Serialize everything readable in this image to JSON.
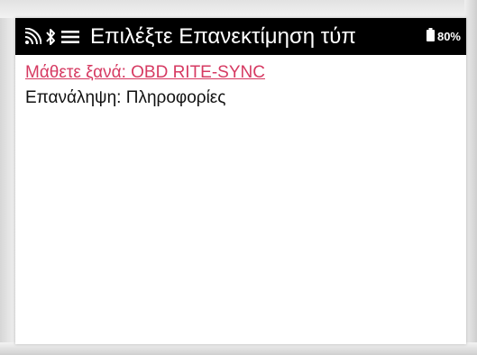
{
  "status_bar": {
    "title": "Επιλέξτε Επανεκτίμηση τύπ",
    "battery_percent": "80%",
    "icons": [
      "signal-icon",
      "bluetooth-icon",
      "menu-icon",
      "battery-icon"
    ],
    "background_color": "#000000",
    "text_color": "#ffffff"
  },
  "menu": {
    "items": [
      {
        "label": "Μάθετε ξανά: OBD RITE-SYNC",
        "selected": true,
        "color": "#d63a62"
      },
      {
        "label": "Επανάληψη: Πληροφορίες",
        "selected": false,
        "color": "#111111"
      }
    ]
  }
}
